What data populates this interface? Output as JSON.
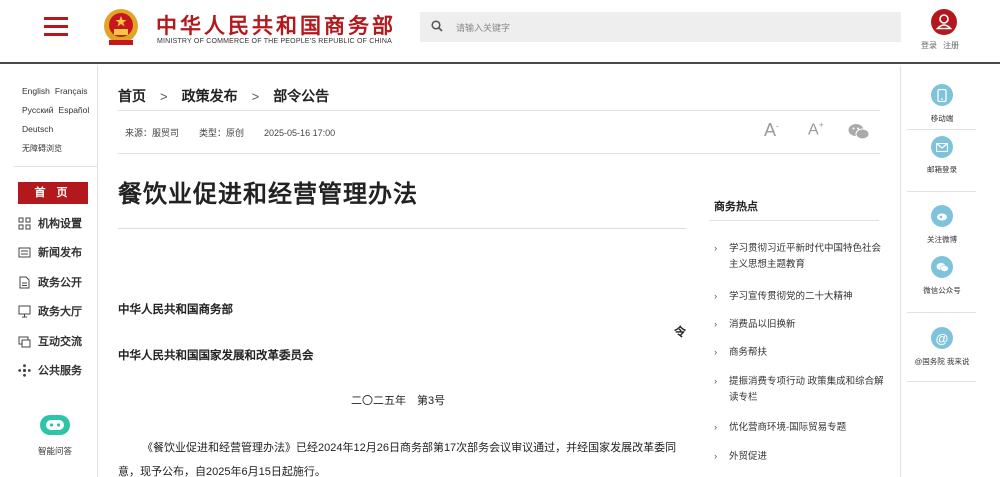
{
  "header": {
    "logo_cn": "中华人民共和国商务部",
    "logo_en": "MINISTRY OF COMMERCE OF THE PEOPLE'S REPUBLIC OF CHINA",
    "search_placeholder": "请输入关键字",
    "login": "登录",
    "register": "注册"
  },
  "languages": [
    "English",
    "Français",
    "Русский",
    "Español",
    "Deutsch",
    "无障碍浏览"
  ],
  "nav": {
    "home": "首 页",
    "items": [
      "机构设置",
      "新闻发布",
      "政务公开",
      "政务大厅",
      "互动交流",
      "公共服务"
    ],
    "assistant": "智能问答"
  },
  "breadcrumb": [
    "首页",
    "政策发布",
    "部令公告"
  ],
  "meta": {
    "source": "来源：服贸司",
    "type": "类型：原创",
    "date": "2025-05-16 17:00"
  },
  "article": {
    "title": "餐饮业促进和经营管理办法",
    "org1": "中华人民共和国商务部",
    "ling": "令",
    "org2": "中华人民共和国国家发展和改革委员会",
    "docno": "二〇二五年　第3号",
    "para": "《餐饮业促进和经营管理办法》已经2024年12月26日商务部第17次部务会议审议通过，并经国家发展改革委同意，现予公布，自2025年6月15日起施行。"
  },
  "hot": {
    "title": "商务热点",
    "items": [
      "学习贯彻习近平新时代中国特色社会主义思想主题教育",
      "学习宣传贯彻党的二十大精神",
      "消费品以旧换新",
      "商务帮扶",
      "提振消费专项行动 政策集成和综合解读专栏",
      "优化营商环境-国际贸易专题",
      "外贸促进"
    ]
  },
  "right_rail": {
    "items": [
      "移动端",
      "邮箱登录",
      "关注微博",
      "微信公众号",
      "@国务院 我来说"
    ]
  },
  "colors": {
    "brand_red": "#b3191c",
    "icon_blue": "#7ec3d9"
  }
}
